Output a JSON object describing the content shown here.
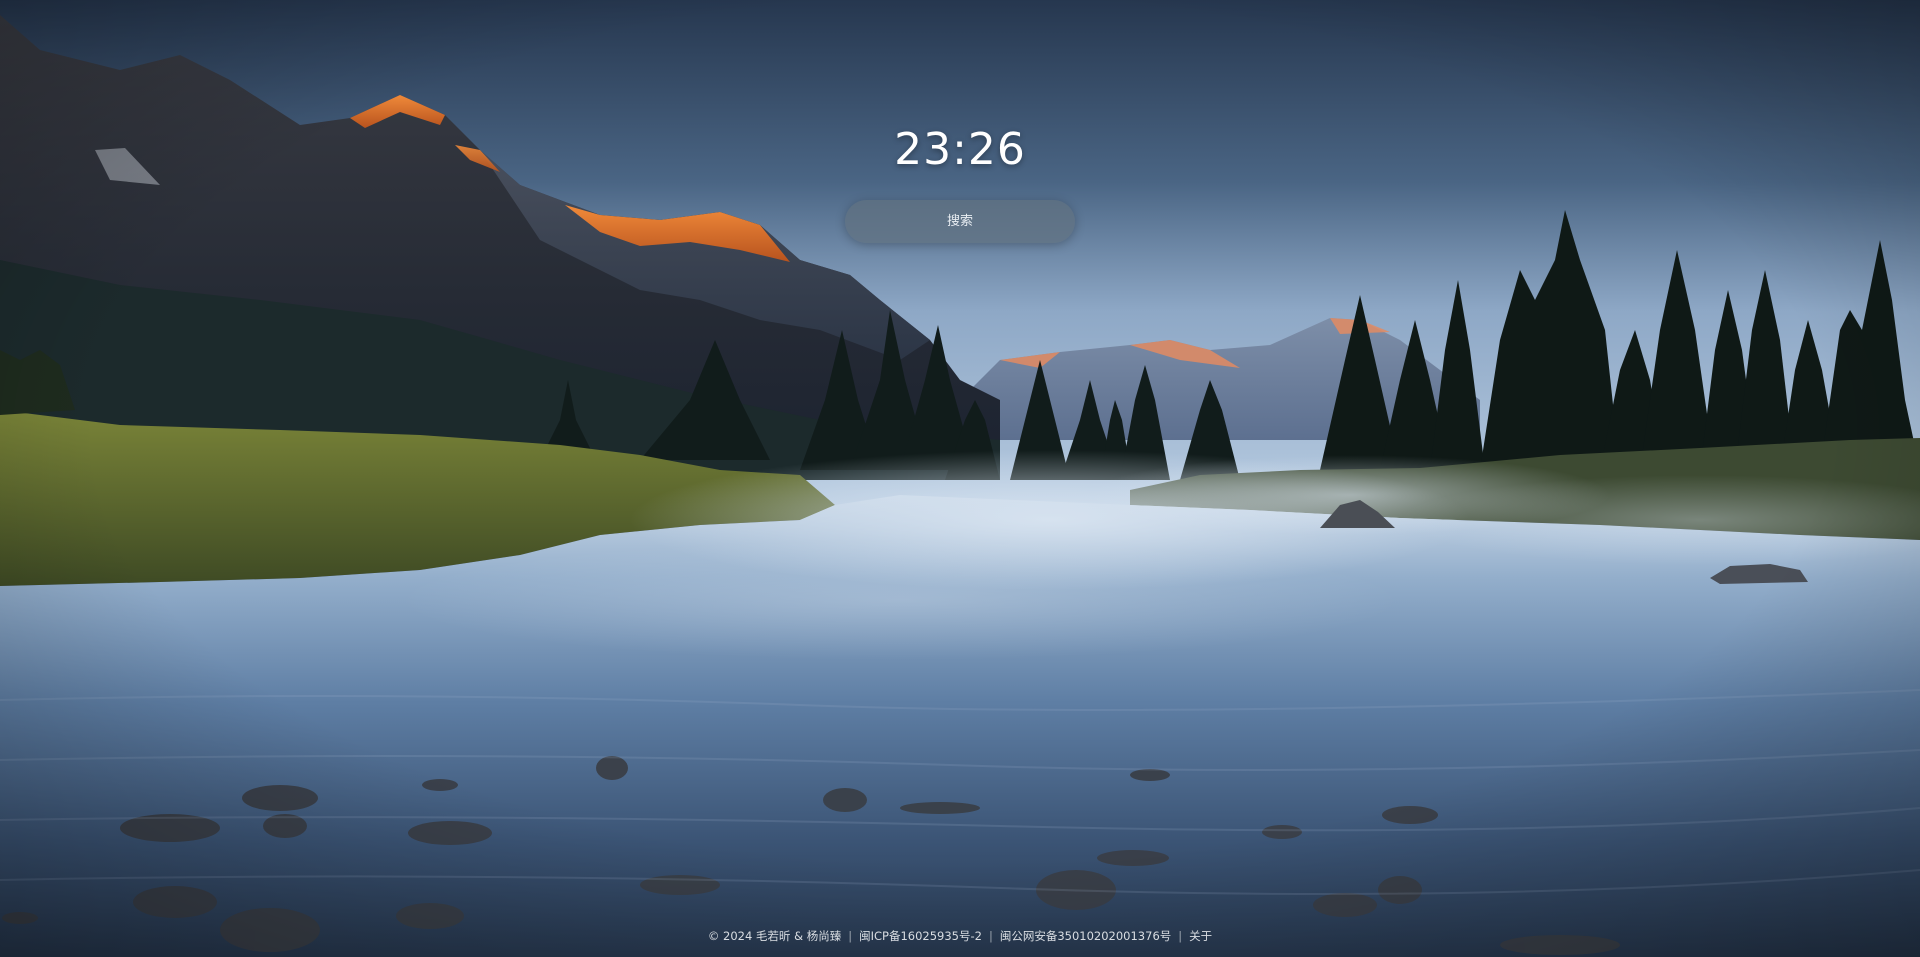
{
  "clock": {
    "time": "23:26"
  },
  "search": {
    "placeholder": "搜索",
    "value": ""
  },
  "footer": {
    "copyright": "© 2024 毛若昕 & 杨尚臻",
    "icp": "闽ICP备16025935号-2",
    "police": "闽公网安备35010202001376号",
    "about": "关于"
  },
  "colors": {
    "sky_top": "#2a3a52",
    "sky_horizon": "#9fb8d6",
    "peak_glow": "#e07028",
    "water": "#5f7fa6",
    "grass": "#5f6a2e",
    "trees": "#14201c"
  },
  "background": {
    "icon": "mountain-lake-photo"
  }
}
